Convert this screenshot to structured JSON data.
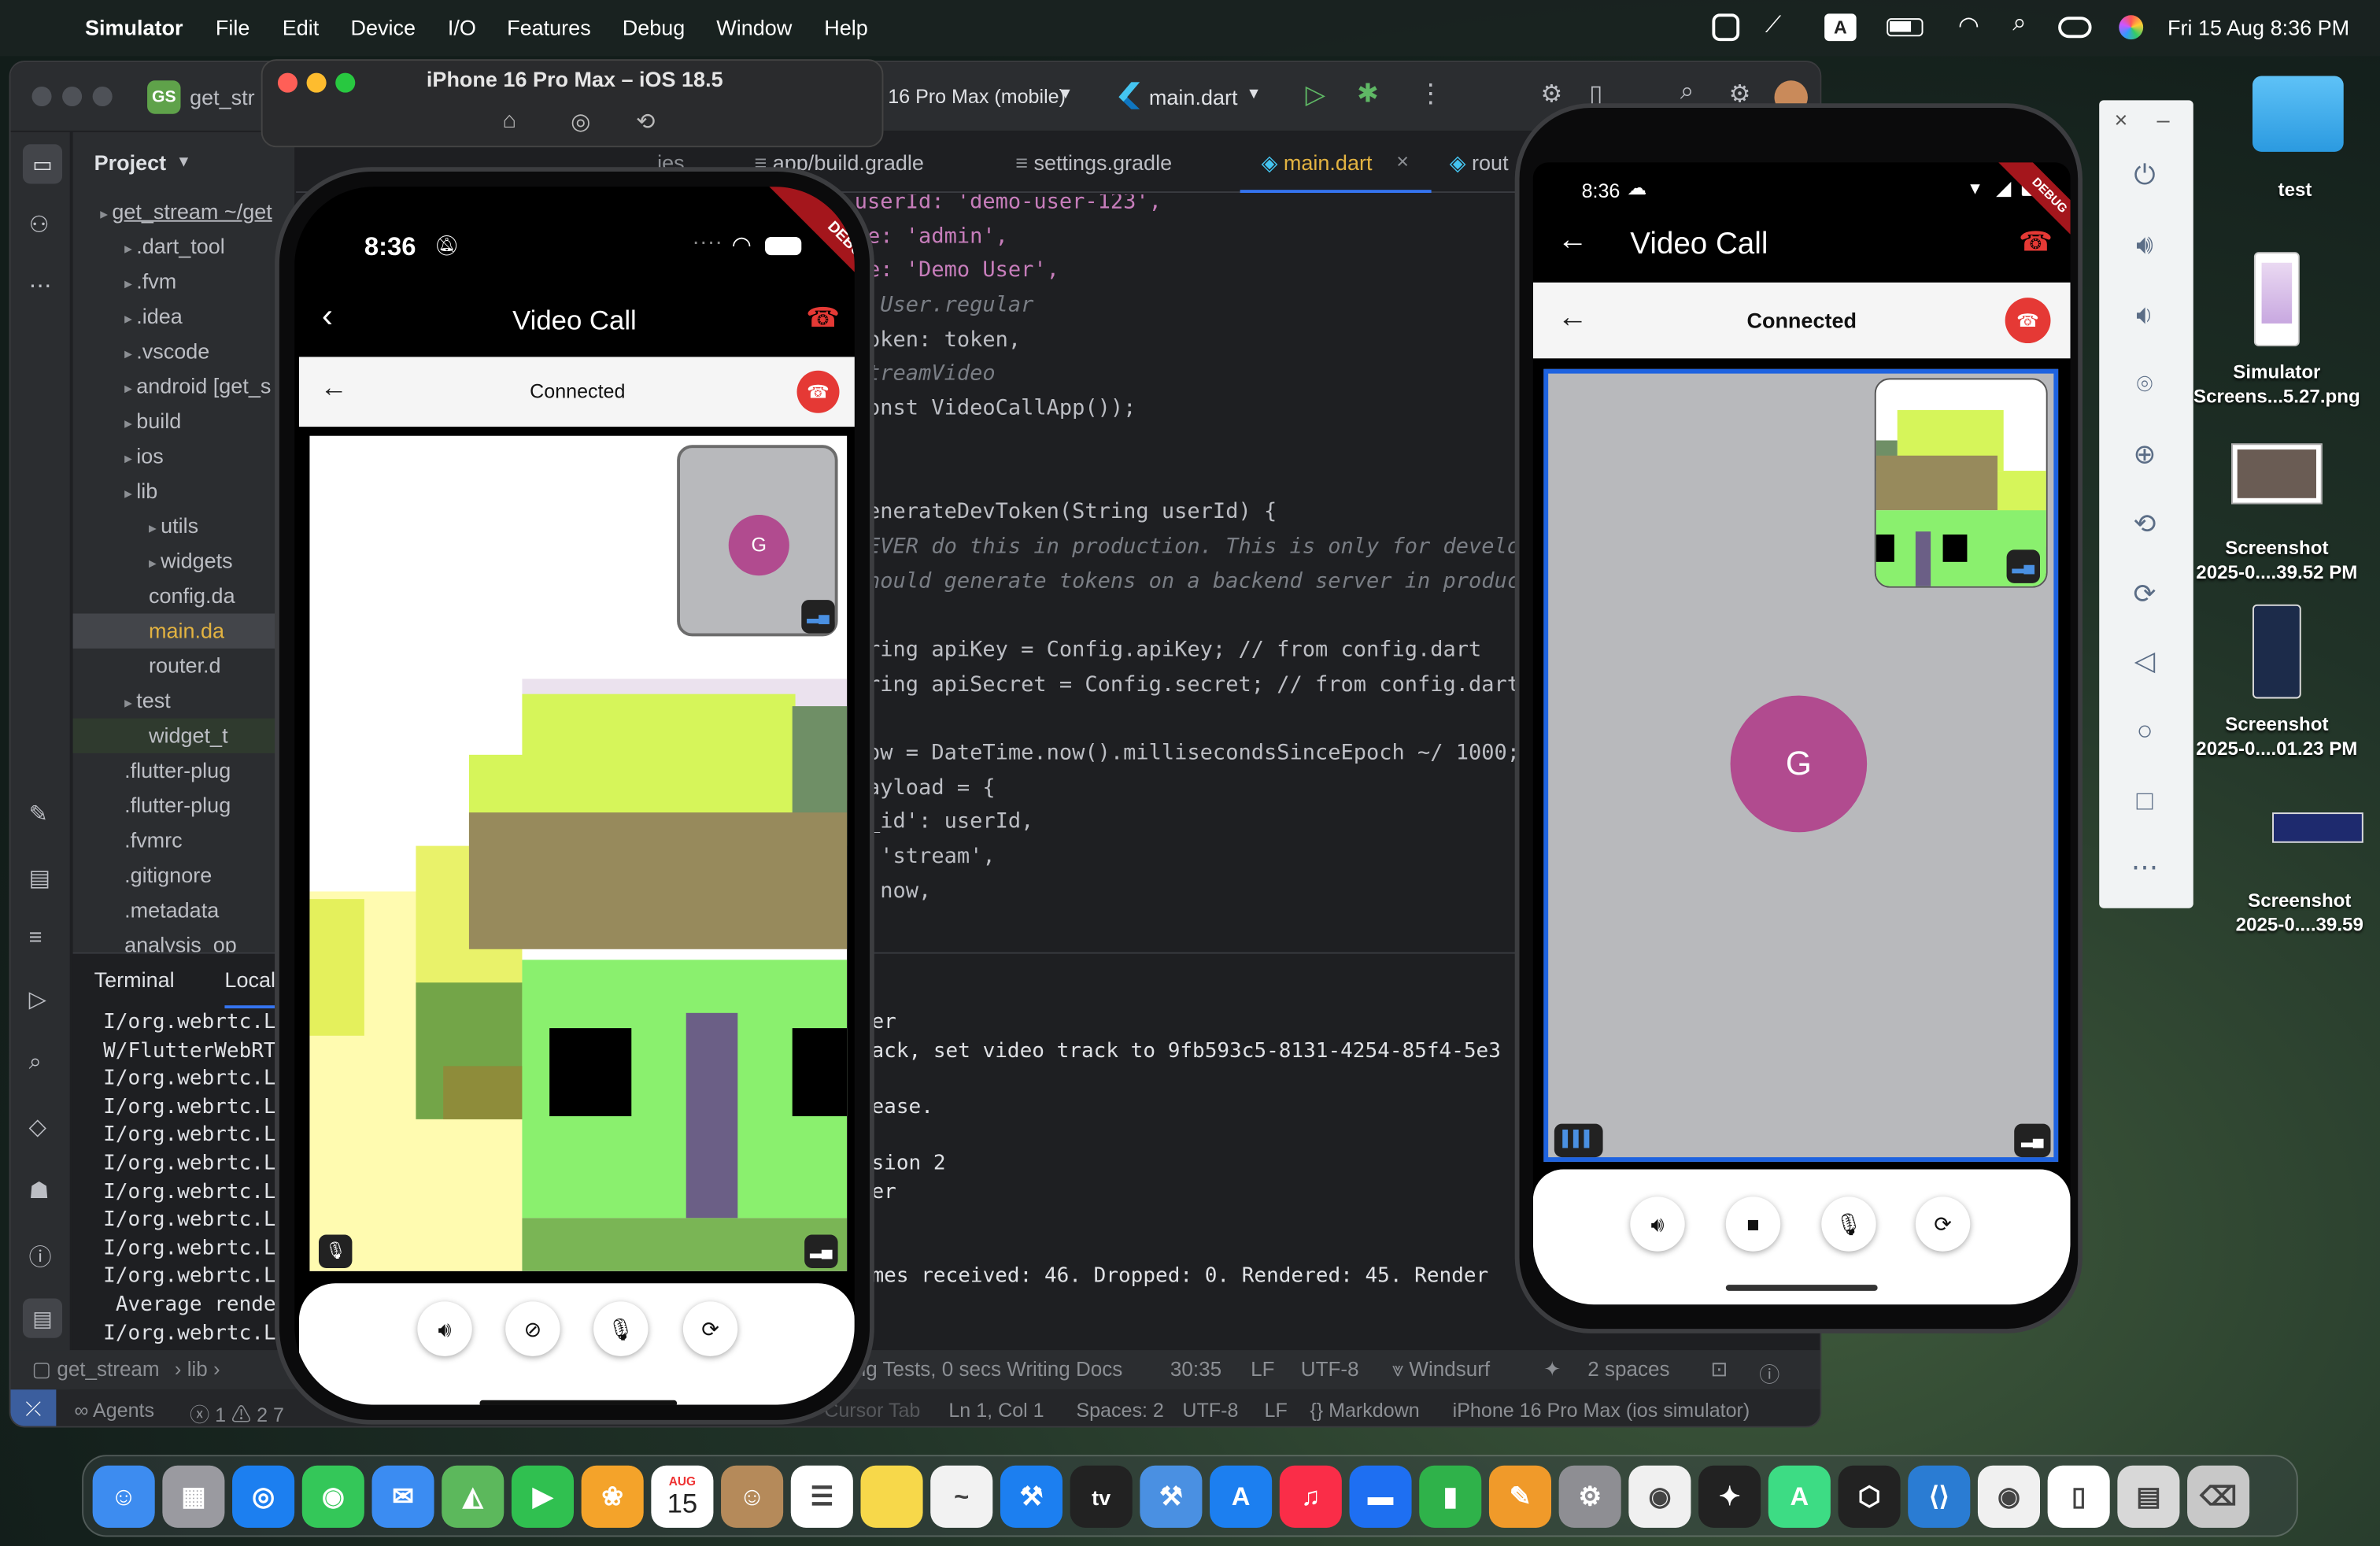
{
  "menubar": {
    "app": "Simulator",
    "items": [
      "File",
      "Edit",
      "Device",
      "I/O",
      "Features",
      "Debug",
      "Window",
      "Help"
    ],
    "datetime": "Fri 15 Aug  8:36 PM",
    "input_badge": "A"
  },
  "simulator": {
    "title": "iPhone 16 Pro Max – iOS 18.5"
  },
  "ide": {
    "project_badge": "GS",
    "project_short": "get_str",
    "device_selector": "16 Pro Max (mobile)",
    "run_config": "main.dart",
    "tabs": [
      "ies",
      "app/build.gradle",
      "settings.gradle",
      "main.dart",
      "rout"
    ],
    "project_panel": "Project",
    "tree": [
      {
        "label": "get_stream ~/get",
        "depth": 0
      },
      {
        "label": ".dart_tool",
        "depth": 1
      },
      {
        "label": ".fvm",
        "depth": 1
      },
      {
        "label": ".idea",
        "depth": 1
      },
      {
        "label": ".vscode",
        "depth": 1
      },
      {
        "label": "android [get_s",
        "depth": 1
      },
      {
        "label": "build",
        "depth": 1
      },
      {
        "label": "ios",
        "depth": 1
      },
      {
        "label": "lib",
        "depth": 1
      },
      {
        "label": "utils",
        "depth": 2
      },
      {
        "label": "widgets",
        "depth": 2
      },
      {
        "label": "config.da",
        "depth": 2
      },
      {
        "label": "main.da",
        "depth": 2
      },
      {
        "label": "router.d",
        "depth": 2
      },
      {
        "label": "test",
        "depth": 1
      },
      {
        "label": "widget_t",
        "depth": 2
      },
      {
        "label": ".flutter-plug",
        "depth": 1
      },
      {
        "label": ".flutter-plug",
        "depth": 1
      },
      {
        "label": ".fvmrc",
        "depth": 1
      },
      {
        "label": ".gitignore",
        "depth": 1
      },
      {
        "label": ".metadata",
        "depth": 1
      },
      {
        "label": "analysis_op",
        "depth": 1
      }
    ],
    "code": [
      "userId: 'demo-user-123',",
      "le: 'admin',",
      "me: 'Demo User',",
      "/ User.regular",
      "Token: token,",
      "StreamVideo",
      "const VideoCallApp());",
      "",
      "",
      "generateDevToken(String userId) {",
      "NEVER do this in production. This is only for develop",
      "should generate tokens on a backend server in produc",
      "",
      "tring apiKey = Config.apiKey; // from config.dart",
      "tring apiSecret = Config.secret; // from config.dart",
      "",
      "now = DateTime.now().millisecondsSinceEpoch ~/ 1000;",
      "payload = {",
      "r_id': userId,",
      ": 'stream',",
      ": now,"
    ],
    "terminal_tabs": [
      "Terminal",
      "Local"
    ],
    "terminal_left": [
      "I/org.webrtc.L",
      "W/FlutterWebRT",
      "I/org.webrtc.L",
      "I/org.webrtc.L",
      "I/org.webrtc.L",
      "I/org.webrtc.L",
      "I/org.webrtc.L",
      "I/org.webrtc.L",
      "I/org.webrtc.L",
      "I/org.webrtc.L",
      " Average rende",
      "I/org.webrtc.L"
    ],
    "terminal_right": [
      "erer",
      "Track, set video track to 9fb593c5-8131-4254-85f4-5e3",
      "",
      "elease.",
      "",
      "ersion 2",
      "erer",
      "",
      "",
      "rames received: 46. Dropped: 0. Rendered: 45. Render"
    ],
    "breadcrumb": [
      "get_stream",
      "lib"
    ],
    "status_center": "ng Tests, 0 secs Writing Docs",
    "status_items": [
      "30:35",
      "LF",
      "UTF-8",
      "Windsurf",
      "2 spaces"
    ],
    "bottom_items": [
      "Agents",
      "1",
      "2",
      "7",
      "Cursor Tab",
      "Ln 1, Col 1",
      "Spaces: 2",
      "UTF-8",
      "LF",
      "{} Markdown",
      "iPhone 16 Pro Max (ios simulator)"
    ]
  },
  "ios_phone": {
    "time": "8:36",
    "banner": "DEBUG",
    "appbar_title": "Video Call",
    "connected": "Connected",
    "avatar": "G"
  },
  "android_phone": {
    "time": "8:36",
    "banner": "DEBUG",
    "appbar_title": "Video Call",
    "connected": "Connected",
    "avatar": "G"
  },
  "desktop": {
    "items": [
      {
        "label": "test",
        "icon": "folder-icon"
      },
      {
        "label": "Simulator\nScreens...5.27.png",
        "icon": "png-file-icon"
      },
      {
        "label": "Screenshot\n2025-0....39.52 PM",
        "icon": "screenshot-file-icon"
      },
      {
        "label": "Screenshot\n2025-0....01.23 PM",
        "icon": "screenshot-file-icon"
      },
      {
        "label": "Screenshot\n2025-0....39.59",
        "icon": "screenshot-file-icon"
      }
    ]
  },
  "dock": {
    "items": [
      "Finder",
      "Launchpad",
      "Safari",
      "Messages",
      "Mail",
      "Maps",
      "FaceTime",
      "Photos",
      "Calendar",
      "Contacts",
      "Reminders",
      "Notes",
      "Freeform",
      "Xcode",
      "TV",
      "Instruments",
      "App Store",
      "Music",
      "Keynote",
      "Numbers",
      "Pages",
      "System Settings",
      "Chrome",
      "Figma",
      "Android Studio",
      "Cursor",
      "VS Code",
      "Chrome Canary",
      "Simulator",
      "Files",
      "Trash"
    ],
    "calendar_month": "AUG",
    "calendar_day": "15",
    "tv_label": "tv"
  }
}
